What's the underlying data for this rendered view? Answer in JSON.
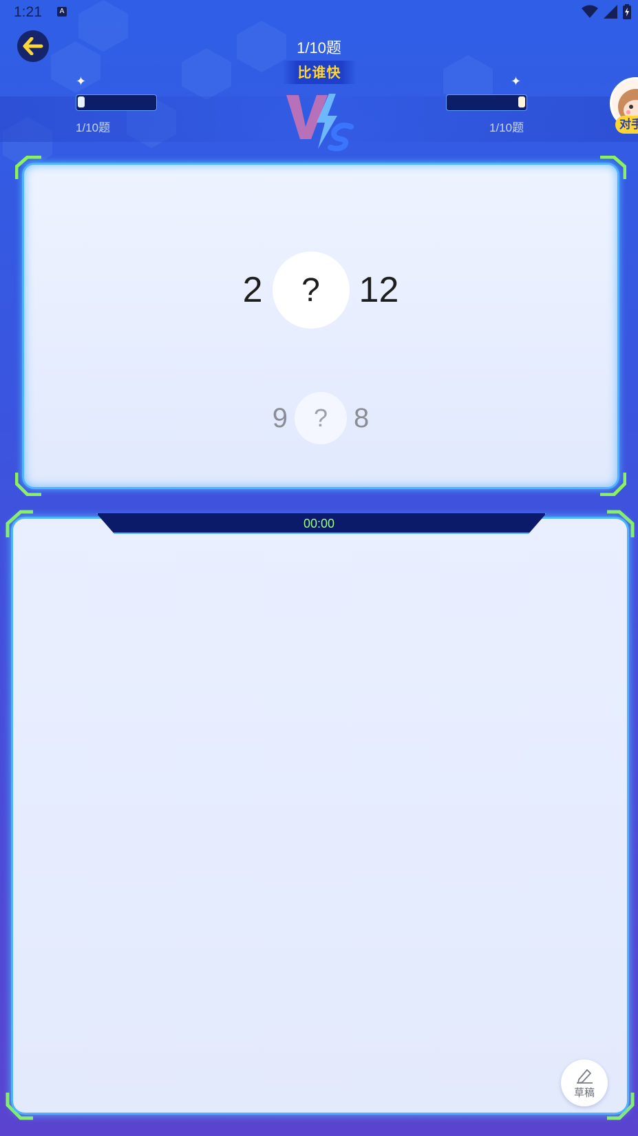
{
  "status_bar": {
    "time": "1:21",
    "notification_glyph": "A",
    "icons": [
      "wifi-icon",
      "signal-icon",
      "battery-icon"
    ]
  },
  "header": {
    "question_counter": "1/10题",
    "mode_title": "比谁快",
    "player": {
      "progress_label": "1/10题",
      "progress_fraction": 0.1
    },
    "opponent": {
      "progress_label": "1/10题",
      "progress_fraction": 1.0,
      "badge": "对手"
    }
  },
  "question": {
    "current": {
      "left": "2",
      "operator": "?",
      "right": "12"
    },
    "next": {
      "left": "9",
      "operator": "?",
      "right": "8"
    }
  },
  "answer_panel": {
    "timer": "00:00",
    "draft_label": "草稿"
  },
  "colors": {
    "accent_green": "#8ef35a",
    "frame_blue": "#4db2ff",
    "timer_text": "#9dff7a",
    "title_yellow": "#ffd633"
  }
}
